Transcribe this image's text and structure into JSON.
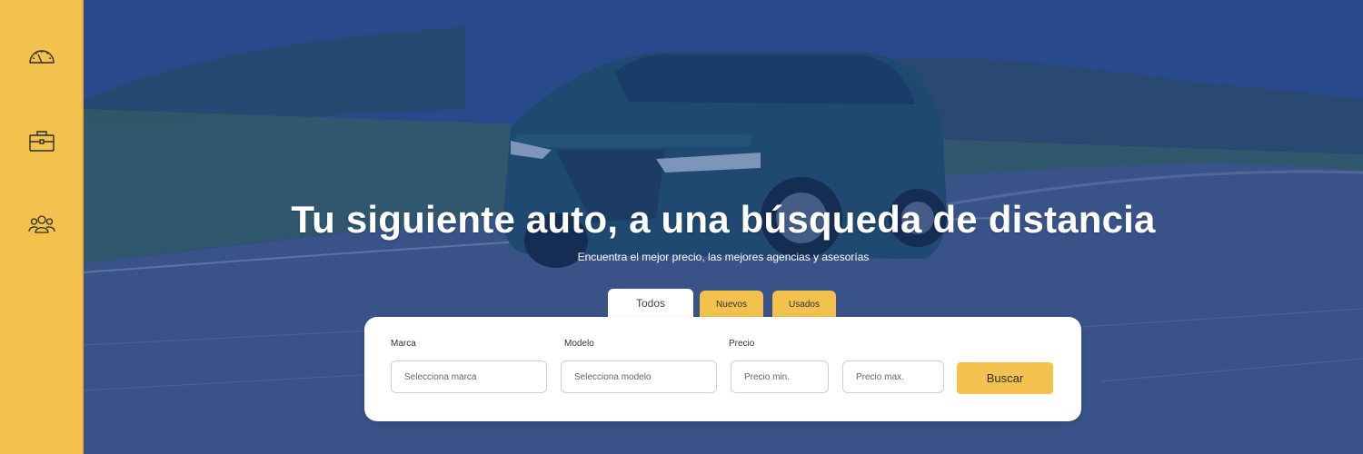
{
  "sidebar": {
    "items": [
      {
        "icon": "speedometer-icon"
      },
      {
        "icon": "briefcase-icon"
      },
      {
        "icon": "users-icon"
      }
    ]
  },
  "hero": {
    "title": "Tu siguiente auto, a una búsqueda de distancia",
    "subtitle": "Encuentra el mejor precio, las mejores agencias y asesorías"
  },
  "tabs": [
    {
      "label": "Todos",
      "active": true
    },
    {
      "label": "Nuevos",
      "active": false
    },
    {
      "label": "Usados",
      "active": false
    }
  ],
  "search": {
    "marca_label": "Marca",
    "marca_placeholder": "Selecciona marca",
    "modelo_label": "Modelo",
    "modelo_placeholder": "Selecciona modelo",
    "precio_label": "Precio",
    "precio_min_placeholder": "Precio min.",
    "precio_max_placeholder": "Precio max.",
    "button_label": "Buscar"
  },
  "colors": {
    "accent": "#f2c14e",
    "overlay": "#2b4f8f",
    "card": "#ffffff"
  }
}
